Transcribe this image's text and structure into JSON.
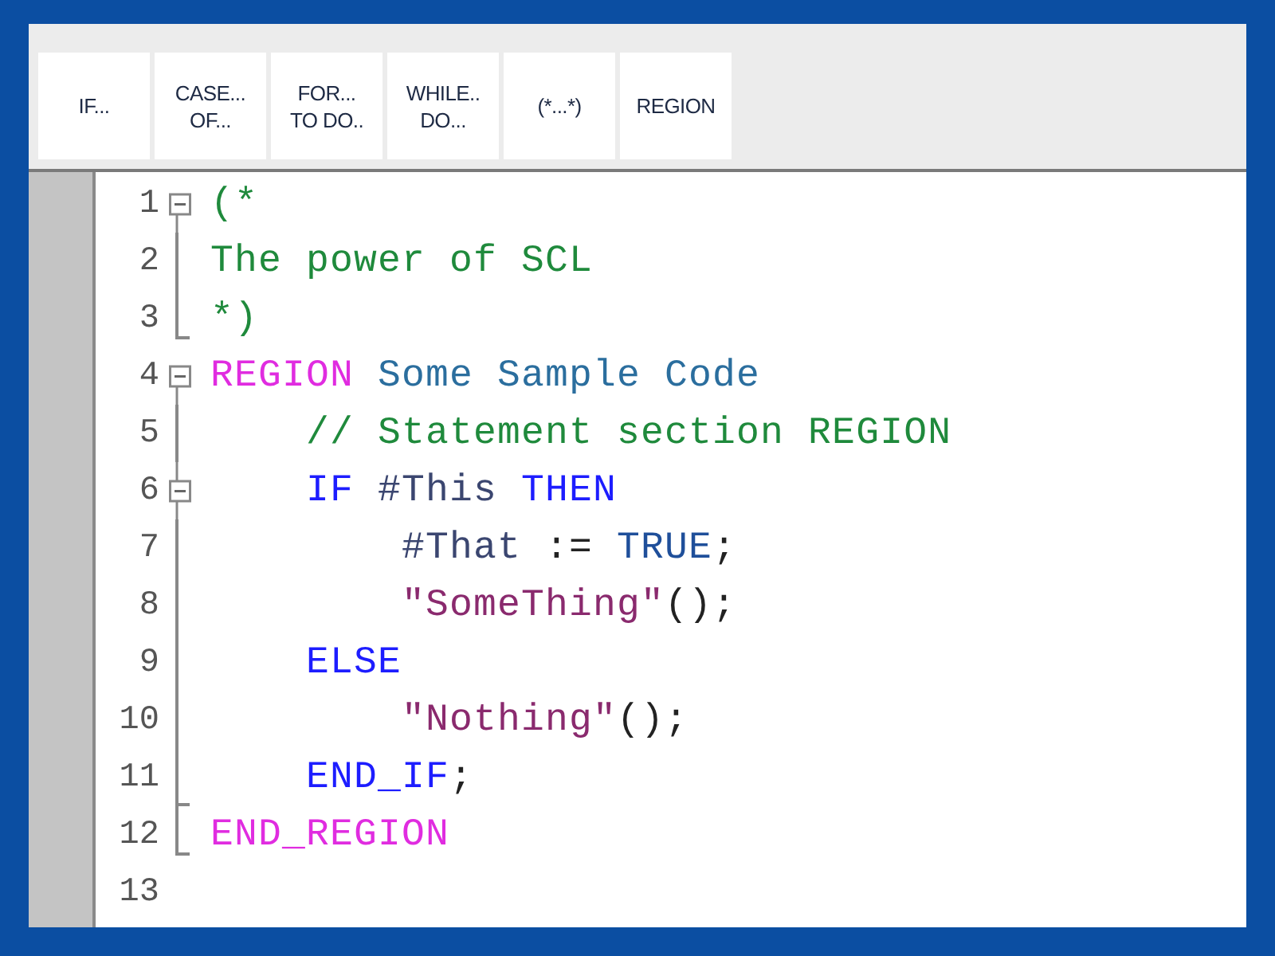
{
  "toolbar": {
    "buttons": [
      {
        "lines": [
          "IF..."
        ]
      },
      {
        "lines": [
          "CASE...",
          "OF..."
        ]
      },
      {
        "lines": [
          "FOR...",
          "TO DO.."
        ]
      },
      {
        "lines": [
          "WHILE..",
          "DO..."
        ]
      },
      {
        "lines": [
          "(*...*)"
        ]
      },
      {
        "lines": [
          "REGION"
        ]
      }
    ]
  },
  "editor": {
    "lines": [
      {
        "number": "1",
        "collapsible": true,
        "block_end": false,
        "tokens": [
          {
            "kind": "comment",
            "text": "(*"
          }
        ]
      },
      {
        "number": "2",
        "collapsible": false,
        "block_end": false,
        "tokens": [
          {
            "kind": "comment",
            "text": "The power of SCL"
          }
        ]
      },
      {
        "number": "3",
        "collapsible": false,
        "block_end": true,
        "tokens": [
          {
            "kind": "comment",
            "text": "*)"
          }
        ]
      },
      {
        "number": "4",
        "collapsible": true,
        "block_end": false,
        "tokens": [
          {
            "kind": "region",
            "text": "REGION"
          },
          {
            "kind": "name",
            "text": " Some Sample Code"
          }
        ]
      },
      {
        "number": "5",
        "collapsible": false,
        "block_end": false,
        "tokens": [
          {
            "kind": "comment",
            "text": "    // Statement section REGION"
          }
        ]
      },
      {
        "number": "6",
        "collapsible": true,
        "block_end": false,
        "tokens": [
          {
            "kind": "keyword",
            "text": "    IF"
          },
          {
            "kind": "variable",
            "text": " #This"
          },
          {
            "kind": "keyword",
            "text": " THEN"
          }
        ]
      },
      {
        "number": "7",
        "collapsible": false,
        "block_end": false,
        "tokens": [
          {
            "kind": "variable",
            "text": "        #That"
          },
          {
            "kind": "plain",
            "text": " := "
          },
          {
            "kind": "constant",
            "text": "TRUE"
          },
          {
            "kind": "plain",
            "text": ";"
          }
        ]
      },
      {
        "number": "8",
        "collapsible": false,
        "block_end": false,
        "tokens": [
          {
            "kind": "string",
            "text": "        \"SomeThing\""
          },
          {
            "kind": "plain",
            "text": "();"
          }
        ]
      },
      {
        "number": "9",
        "collapsible": false,
        "block_end": false,
        "tokens": [
          {
            "kind": "keyword",
            "text": "    ELSE"
          }
        ]
      },
      {
        "number": "10",
        "collapsible": false,
        "block_end": false,
        "tokens": [
          {
            "kind": "string",
            "text": "        \"Nothing\""
          },
          {
            "kind": "plain",
            "text": "();"
          }
        ]
      },
      {
        "number": "11",
        "collapsible": false,
        "block_end": true,
        "tokens": [
          {
            "kind": "keyword",
            "text": "    END_IF"
          },
          {
            "kind": "plain",
            "text": ";"
          }
        ]
      },
      {
        "number": "12",
        "collapsible": false,
        "block_end": true,
        "tokens": [
          {
            "kind": "region",
            "text": "END_REGION"
          }
        ]
      },
      {
        "number": "13",
        "collapsible": false,
        "block_end": false
      }
    ]
  }
}
